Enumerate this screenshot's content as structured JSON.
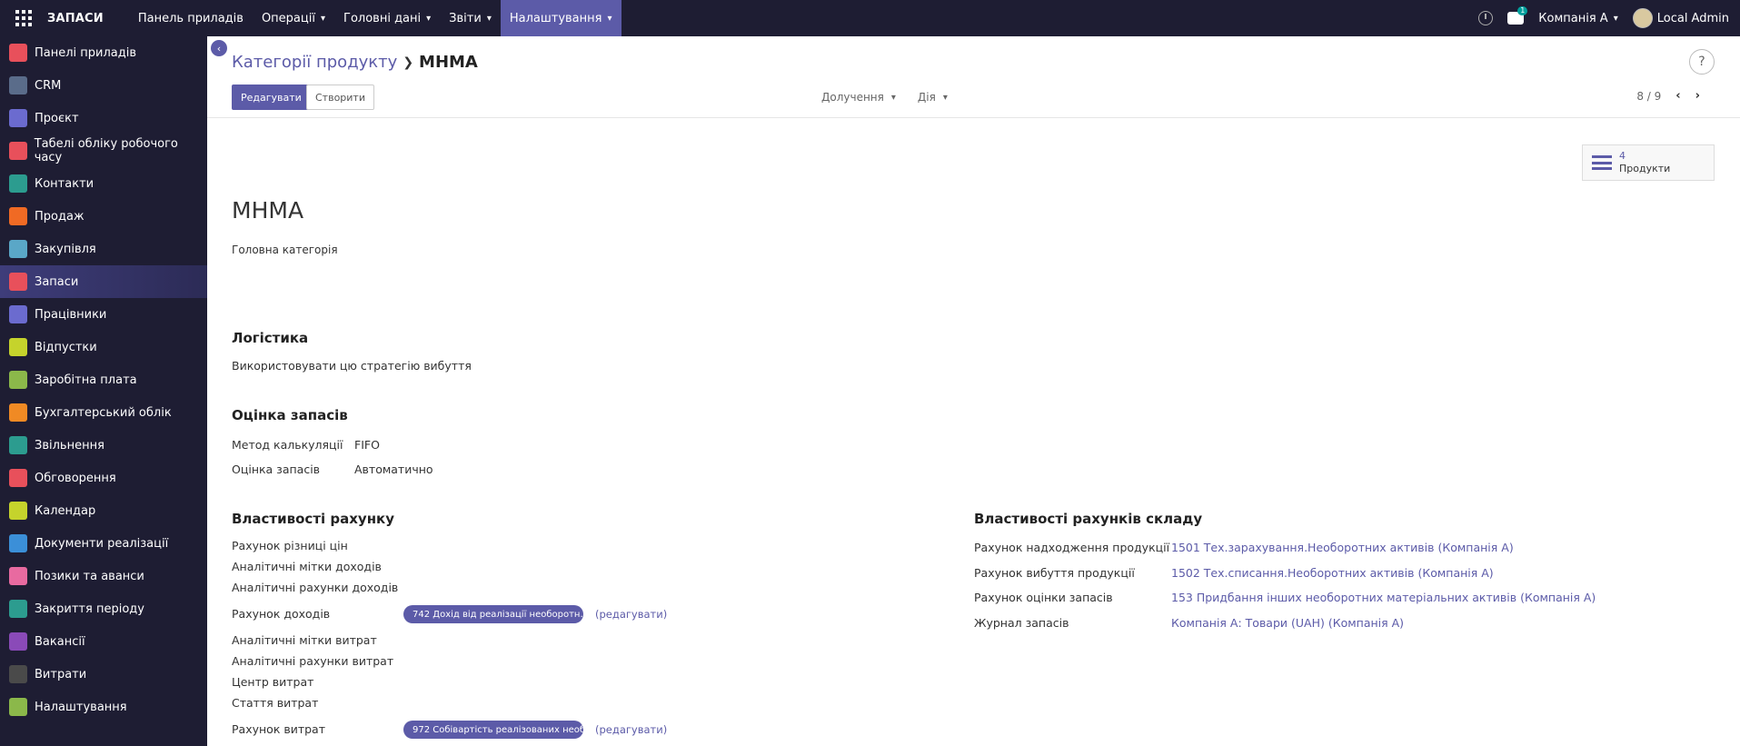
{
  "topbar": {
    "brand": "ЗАПАСИ",
    "menu": [
      "Панель приладів",
      "Операції",
      "Головні дані",
      "Звіти",
      "Налаштування"
    ],
    "chat_badge": "1",
    "company": "Компанія А",
    "user": "Local Admin"
  },
  "sidebar": {
    "items": [
      {
        "label": "Панелі приладів",
        "color": "#e8505b"
      },
      {
        "label": "CRM",
        "color": "#5a6c8a"
      },
      {
        "label": "Проєкт",
        "color": "#6b6bcf"
      },
      {
        "label": "Табелі обліку робочого часу",
        "color": "#e8505b"
      },
      {
        "label": "Контакти",
        "color": "#2c9c8f"
      },
      {
        "label": "Продаж",
        "color": "#f06a24"
      },
      {
        "label": "Закупівля",
        "color": "#5aa7c7"
      },
      {
        "label": "Запаси",
        "color": "#e8505b"
      },
      {
        "label": "Працівники",
        "color": "#6b6bcf"
      },
      {
        "label": "Відпустки",
        "color": "#c5d32c"
      },
      {
        "label": "Заробітна плата",
        "color": "#8bb84a"
      },
      {
        "label": "Бухгалтерський облік",
        "color": "#f08a24"
      },
      {
        "label": "Звільнення",
        "color": "#2c9c8f"
      },
      {
        "label": "Обговорення",
        "color": "#e8505b"
      },
      {
        "label": "Календар",
        "color": "#c5d32c"
      },
      {
        "label": "Документи реалізації",
        "color": "#3b8fd8"
      },
      {
        "label": "Позики та аванси",
        "color": "#e86aa0"
      },
      {
        "label": "Закриття періоду",
        "color": "#2c9c8f"
      },
      {
        "label": "Вакансії",
        "color": "#8a4ab8"
      },
      {
        "label": "Витрати",
        "color": "#4a4a4a"
      },
      {
        "label": "Налаштування",
        "color": "#8bb84a"
      }
    ],
    "active_index": 7
  },
  "control": {
    "back_label": "‹",
    "breadcrumb_parent": "Категорії продукту",
    "breadcrumb_current": "MHMA",
    "edit_label": "Редагувати",
    "create_label": "Створити",
    "attach_label": "Долучення",
    "action_label": "Дія",
    "pager": "8 / 9",
    "help": "?"
  },
  "smart_button": {
    "count": "4",
    "label": "Продукти"
  },
  "form": {
    "name": "MHMA",
    "parent_category": "Головна категорія",
    "logistics": {
      "title": "Логістика",
      "removal_strategy_label": "Використовувати цю стратегію вибуття"
    },
    "valuation": {
      "title": "Оцінка запасів",
      "costing_method_label": "Метод калькуляції",
      "costing_method_value": "FIFO",
      "valuation_label": "Оцінка запасів",
      "valuation_value": "Автоматично"
    },
    "account_props": {
      "title": "Властивості рахунку",
      "price_diff": "Рахунок різниці цін",
      "income_tags": "Аналітичні мітки доходів",
      "income_analytic": "Аналітичні рахунки доходів",
      "income_account_label": "Рахунок доходів",
      "income_account_value": "742 Дохід від реалізації необоротн...",
      "edit_link": "(редагувати)",
      "expense_tags": "Аналітичні мітки витрат",
      "expense_analytic": "Аналітичні рахунки витрат",
      "cost_center": "Центр витрат",
      "expense_item": "Стаття витрат",
      "expense_account_label": "Рахунок витрат",
      "expense_account_value": "972 Собівартість реалізованих необ..."
    },
    "stock_props": {
      "title": "Властивості рахунків складу",
      "rows": [
        {
          "label": "Рахунок надходження продукції",
          "value": "1501 Тех.зарахування.Необоротних активів (Компанія А)"
        },
        {
          "label": "Рахунок вибуття продукції",
          "value": "1502 Тех.списання.Необоротних активів (Компанія А)"
        },
        {
          "label": "Рахунок оцінки запасів",
          "value": "153 Придбання інших необоротних матеріальних активів (Компанія А)"
        },
        {
          "label": "Журнал запасів",
          "value": "Компанія А: Товари (UAH) (Компанія А)"
        }
      ]
    }
  }
}
